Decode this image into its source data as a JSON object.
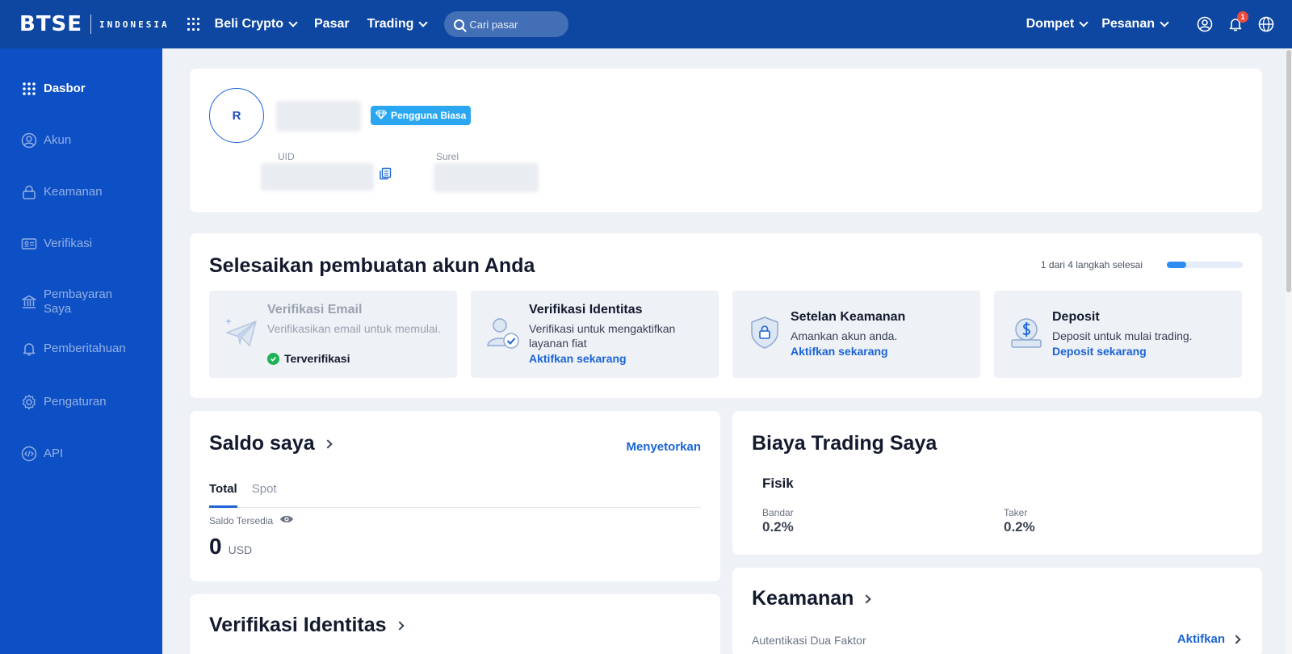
{
  "header": {
    "logo_main": "BTSE",
    "logo_sub": "INDONESIA",
    "nav": [
      {
        "label": "Beli Crypto"
      },
      {
        "label": "Pasar"
      },
      {
        "label": "Trading"
      }
    ],
    "search_placeholder": "Cari pasar",
    "right_nav": [
      {
        "label": "Dompet"
      },
      {
        "label": "Pesanan"
      }
    ],
    "notification_count": "1",
    "icons": [
      "apps-icon",
      "search-icon",
      "user-icon",
      "bell-icon",
      "globe-icon"
    ]
  },
  "sidebar": {
    "items": [
      {
        "label": "Dasbor",
        "icon": "dashboard-icon",
        "active": true
      },
      {
        "label": "Akun",
        "icon": "user-icon"
      },
      {
        "label": "Keamanan",
        "icon": "lock-icon"
      },
      {
        "label": "Verifikasi",
        "icon": "id-card-icon"
      },
      {
        "label": "Pembayaran Saya",
        "icon": "bank-icon"
      },
      {
        "label": "Pemberitahuan",
        "icon": "bell-icon"
      },
      {
        "label": "Pengaturan",
        "icon": "gear-icon"
      },
      {
        "label": "API",
        "icon": "code-icon"
      }
    ]
  },
  "profile": {
    "avatar_initial": "R",
    "tier_badge": "Pengguna Biasa",
    "uid_label": "UID",
    "email_label": "Surel"
  },
  "setup": {
    "title": "Selesaikan pembuatan akun Anda",
    "progress_text": "1 dari 4 langkah selesai",
    "progress_fraction": 0.25,
    "steps": [
      {
        "title": "Verifikasi Email",
        "desc": "Verifikasikan email untuk memulai.",
        "status": "Terverifikasi",
        "icon": "paper-plane-icon"
      },
      {
        "title": "Verifikasi Identitas",
        "desc": "Verifikasi untuk mengaktifkan layanan fiat",
        "link": "Aktifkan sekarang",
        "icon": "user-check-icon"
      },
      {
        "title": "Setelan Keamanan",
        "desc": "Amankan akun anda.",
        "link": "Aktifkan sekarang",
        "icon": "shield-lock-icon"
      },
      {
        "title": "Deposit",
        "desc": "Deposit untuk mulai trading.",
        "link": "Deposit sekarang",
        "icon": "dollar-coin-icon"
      }
    ]
  },
  "balance": {
    "title": "Saldo saya",
    "deposit_link": "Menyetorkan",
    "tabs": [
      {
        "label": "Total",
        "active": true
      },
      {
        "label": "Spot"
      }
    ],
    "available_label": "Saldo Tersedia",
    "value": "0",
    "currency": "USD"
  },
  "fees": {
    "title": "Biaya Trading Saya",
    "subtitle": "Fisik",
    "maker_label": "Bandar",
    "maker_value": "0.2%",
    "taker_label": "Taker",
    "taker_value": "0.2%"
  },
  "identity": {
    "title": "Verifikasi Identitas"
  },
  "security": {
    "title": "Keamanan",
    "twofa_label": "Autentikasi Dua Faktor",
    "twofa_link": "Aktifkan"
  },
  "colors": {
    "topbar": "#0d47a1",
    "sidebar": "#0d4fc4",
    "accent": "#1a64d6",
    "badge": "#2aa7f0",
    "success": "#1eb257"
  }
}
